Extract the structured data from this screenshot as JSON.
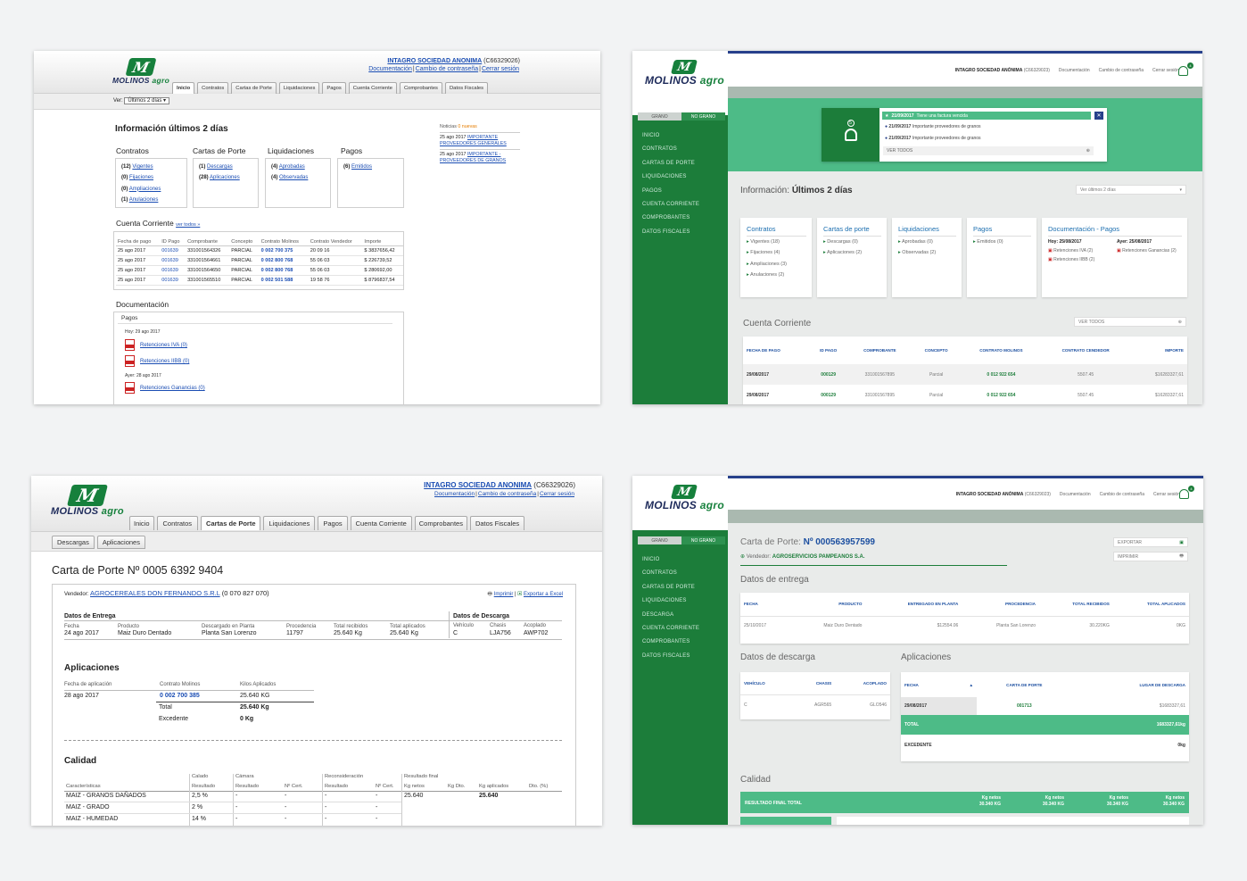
{
  "a": {
    "logo_word": "MOLINOS",
    "logo_word2": "agro",
    "user_name": "INTAGRO SOCIEDAD ANONIMA",
    "user_code": "(C66329026)",
    "user_links": [
      "Documentación",
      "Cambio de contraseña",
      "Cerrar sesión"
    ],
    "tabs": [
      "Inicio",
      "Contratos",
      "Cartas de Porte",
      "Liquidaciones",
      "Pagos",
      "Cuenta Corriente",
      "Comprobantes",
      "Datos Fiscales"
    ],
    "ver_label": "Ver:",
    "ver_value": "Últimos 2 días",
    "heading": "Información últimos 2 días",
    "news_title": "Noticias",
    "news_new": "0 nuevas",
    "news": [
      {
        "date": "25 ago 2017",
        "link": "IMPORTANTE PROVEEDORES GENERALES"
      },
      {
        "date": "25 ago 2017",
        "link": "IMPORTANTE - PROVEEDORES DE GRANOS"
      }
    ],
    "groups": [
      {
        "title": "Contratos",
        "items": [
          {
            "n": "(12)",
            "l": "Vigentes"
          },
          {
            "n": "(0)",
            "l": "Fijaciones"
          },
          {
            "n": "(0)",
            "l": "Ampliaciones"
          },
          {
            "n": "(1)",
            "l": "Anulaciones"
          }
        ]
      },
      {
        "title": "Cartas de Porte",
        "items": [
          {
            "n": "(1)",
            "l": "Descargas"
          },
          {
            "n": "(28)",
            "l": "Aplicaciones"
          }
        ]
      },
      {
        "title": "Liquidaciones",
        "items": [
          {
            "n": "(4)",
            "l": "Aprobadas"
          },
          {
            "n": "(4)",
            "l": "Observadas"
          }
        ]
      },
      {
        "title": "Pagos",
        "items": [
          {
            "n": "(6)",
            "l": "Emitidos"
          }
        ]
      }
    ],
    "cc_title": "Cuenta Corriente",
    "cc_link": "ver todos »",
    "cc_cols": [
      "Fecha de pago",
      "ID Pago",
      "Comprobante",
      "Concepto",
      "Contrato Molinos",
      "Contrato Vendedor",
      "Importe"
    ],
    "cc_rows": [
      [
        "25 ago 2017",
        "001639",
        "331001564326",
        "PARCIAL",
        "0 002 700 375",
        "20 09 16",
        "$ 3837656,42"
      ],
      [
        "25 ago 2017",
        "001639",
        "331001564661",
        "PARCIAL",
        "0 002 800 768",
        "55 06 03",
        "$ 226739,52"
      ],
      [
        "25 ago 2017",
        "001639",
        "331001564650",
        "PARCIAL",
        "0 002 800 768",
        "55 06 03",
        "$ 280692,00"
      ],
      [
        "25 ago 2017",
        "001639",
        "331001565510",
        "PARCIAL",
        "0 002 501 588",
        "19 58 76",
        "$ 8796837,54"
      ]
    ],
    "doc_title": "Documentación",
    "doc_tab": "Pagos",
    "doc_today": "Hoy: 29 ago 2017",
    "doc_yest": "Ayer: 28 ago 2017",
    "doc_items": [
      "Retenciones IVA (0)",
      "Retenciones IIBB (0)",
      "Retenciones Ganancias (0)"
    ]
  },
  "b": {
    "logo_word": "MOLINOS",
    "logo_word2": "agro",
    "toggle": [
      "GRANO",
      "NO GRANO"
    ],
    "menu": [
      "INICIO",
      "CONTRATOS",
      "CARTAS DE PORTE",
      "LIQUIDACIONES",
      "PAGOS",
      "CUENTA CORRIENTE",
      "COMPROBANTES",
      "DATOS FISCALES"
    ],
    "user": "INTAGRO SOCIEDAD ANÓNIMA",
    "code": "(C66329023)",
    "links": [
      "Documentación",
      "Cambio de contraseña",
      "Cerrar sesión"
    ],
    "bell_count": "4",
    "notif_count": "5",
    "notifs": [
      {
        "d": "21/09/2017",
        "t": "Tiene una factura vencida"
      },
      {
        "d": "21/09/2017",
        "t": "Importante proveedores de granos"
      },
      {
        "d": "21/09/2017",
        "t": "Importante proveedores de granos"
      }
    ],
    "ver_todos": "VER TODOS",
    "info_label": "Información:",
    "info_strong": "Últimos 2 días",
    "select": "Ver últimos 2 días",
    "cards": [
      {
        "title": "Contratos",
        "items": [
          "Vigentes (18)",
          "Fijaciones (4)",
          "Ampliaciones (3)",
          "Anulaciones (2)"
        ]
      },
      {
        "title": "Cartas de porte",
        "items": [
          "Descargas (0)",
          "Aplicaciones (2)"
        ]
      },
      {
        "title": "Liquidaciones",
        "items": [
          "Aprobadas (0)",
          "Observadas (2)"
        ]
      },
      {
        "title": "Pagos",
        "items": [
          "Emitidos (0)"
        ]
      }
    ],
    "doc_title": "Documentación - Pagos",
    "doc_hoy": "Hoy: 25/08/2017",
    "doc_ayer": "Ayer: 25/08/2017",
    "doc_hoy_items": [
      "Retenciones IVA (2)",
      "Retenciones IIBB (2)"
    ],
    "doc_ayer_items": [
      "Retenciones Ganancias (2)"
    ],
    "cc_title": "Cuenta Corriente",
    "cc_btn": "VER TODOS",
    "cc_cols": [
      "FECHA DE PAGO",
      "ID PAGO",
      "COMPROBANTE",
      "CONCEPTO",
      "CONTRATO MOLINOS",
      "CONTRATO CENDEDOR",
      "IMPORTE"
    ],
    "cc_rows": [
      [
        "29/08/2017",
        "000129",
        "331001567895",
        "Parcial",
        "0 012 922 654",
        "5507.45",
        "$16283327,61"
      ],
      [
        "29/08/2017",
        "000129",
        "331001567895",
        "Parcial",
        "0 012 922 654",
        "5507.45",
        "$16283327,61"
      ]
    ]
  },
  "c": {
    "logo_word": "MOLINOS",
    "logo_word2": "agro",
    "user_name": "INTAGRO SOCIEDAD ANONIMA",
    "user_code": "(C66329026)",
    "user_links": [
      "Documentación",
      "Cambio de contraseña",
      "Cerrar sesión"
    ],
    "tabs": [
      "Inicio",
      "Contratos",
      "Cartas de Porte",
      "Liquidaciones",
      "Pagos",
      "Cuenta Corriente",
      "Comprobantes",
      "Datos Fiscales"
    ],
    "subtabs": [
      "Descargas",
      "Aplicaciones"
    ],
    "title": "Carta de Porte Nº 0005 6392 9404",
    "vendedor_label": "Vendedor:",
    "vendedor": "AGROCEREALES DON FERNANDO S.R.L",
    "vendedor_code": "(0 070 827 070)",
    "imprimir": "Imprimir",
    "exportar": "Exportar a Excel",
    "entrega_title": "Datos de Entrega",
    "descarga_title": "Datos de Descarga",
    "entrega_cols": [
      "Fecha",
      "Producto",
      "Descargado en Planta",
      "Procedencia",
      "Total recibidos",
      "Total aplicados"
    ],
    "entrega_vals": [
      "24 ago 2017",
      "Maiz Duro Dentado",
      "Planta San Lorenzo",
      "11797",
      "25.640 Kg",
      "25.640 Kg"
    ],
    "descarga_cols": [
      "Vehículo",
      "Chasis",
      "Acoplado"
    ],
    "descarga_vals": [
      "C",
      "LJA756",
      "AWP702"
    ],
    "apl_title": "Aplicaciones",
    "apl_cols": [
      "Fecha de aplicación",
      "Contrato Molinos",
      "Kilos Aplicados"
    ],
    "apl_row": [
      "28 ago 2017",
      "0 002 700 385",
      "25.640 KG"
    ],
    "total_label": "Total",
    "total_val": "25.640 Kg",
    "exc_label": "Excedente",
    "exc_val": "0 Kg",
    "cal_title": "Calidad",
    "cal_h1": [
      "Calado",
      "Cámara",
      "Reconsideración",
      "Resultado final"
    ],
    "cal_h2": [
      "Características",
      "Resultado",
      "Resultado",
      "Nº Cert.",
      "Resultado",
      "Nº Cert.",
      "Kg netos",
      "Kg Dto.",
      "Kg aplicados",
      "Dto. (%)"
    ],
    "cal_rows": [
      [
        "MAIZ - GRANOS DAÑADOS",
        "2,5 %",
        "-",
        "-",
        "-",
        "-",
        "25.640",
        "",
        "25.640",
        ""
      ],
      [
        "MAIZ - GRADO",
        "2 %",
        "-",
        "-",
        "-",
        "-",
        "",
        "",
        "",
        ""
      ],
      [
        "MAIZ - HUMEDAD",
        "14 %",
        "-",
        "-",
        "-",
        "-",
        "",
        "",
        "",
        ""
      ]
    ]
  },
  "d": {
    "logo_word": "MOLINOS",
    "logo_word2": "agro",
    "toggle": [
      "GRANO",
      "NO GRANO"
    ],
    "menu": [
      "INICIO",
      "CONTRATOS",
      "CARTAS DE PORTE",
      "LIQUIDACIONES",
      "DESCARGA",
      "CUENTA CORRIENTE",
      "COMPROBANTES",
      "DATOS FISCALES"
    ],
    "user": "INTAGRO SOCIEDAD ANÓNIMA",
    "code": "(C66329023)",
    "links": [
      "Documentación",
      "Cambio de contraseña",
      "Cerrar sesión"
    ],
    "bell_count": "4",
    "title_label": "Carta de Porte:",
    "title_num": "Nº 000563957599",
    "vend_label": "Vendedor:",
    "vend": "AGROSERVICIOS PAMPEANOS S.A.",
    "btn_export": "EXPORTAR",
    "btn_print": "IMPRIMIR",
    "entrega_title": "Datos de entrega",
    "entrega_cols": [
      "FECHA",
      "PRODUCTO",
      "ENTREGADO EN PLANTA",
      "PROCEDENCIA",
      "TOTAL RECIBIDOS",
      "TOTAL APLICADOS"
    ],
    "entrega_row": [
      "25/10/2017",
      "Maiz Duro Dentado",
      "$12554.06",
      "Planta San Lorenzo",
      "30.220KG",
      "0KG"
    ],
    "descarga_title": "Datos de descarga",
    "descarga_cols": [
      "VEHÍCULO",
      "CHASIS",
      "ACOPLADO"
    ],
    "descarga_row": [
      "C",
      "AGR565",
      "GLO546"
    ],
    "apl_title": "Aplicaciones",
    "apl_cols": [
      "FECHA",
      "CARTA DE PORTE",
      "LUGAR DE DESCARGA"
    ],
    "apl_row": [
      "29/08/2017",
      "001713",
      "$1683327,61"
    ],
    "total_label": "TOTAL",
    "total_val": "1683327,61kg",
    "exc_label": "EXCEDENTE",
    "exc_val": "0kg",
    "cal_title": "Calidad",
    "cal_head": "RESULTADO FINAL TOTAL",
    "cal_cols": [
      [
        "Kg netos",
        "30.340 KG"
      ],
      [
        "Kg netos",
        "30.340 KG"
      ],
      [
        "Kg netos",
        "30.340 KG"
      ],
      [
        "Kg netos",
        "30.340 KG"
      ]
    ]
  },
  "colors": {
    "green": "#1c7d3a",
    "light_green": "#4dbb87",
    "navy": "#27408b",
    "link": "#1a4db3"
  }
}
